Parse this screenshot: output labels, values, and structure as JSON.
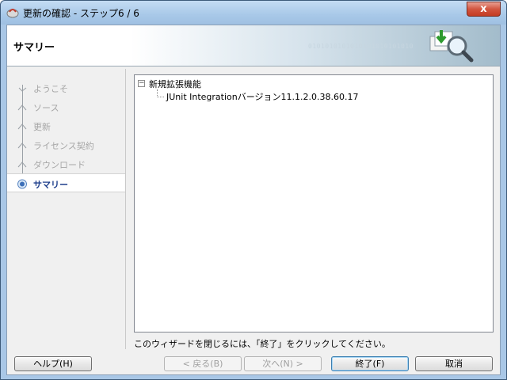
{
  "window": {
    "title": "更新の確認 - ステップ6 / 6",
    "close_glyph": "x"
  },
  "banner": {
    "title": "サマリー",
    "binary_text": "0101010101010101010101010",
    "icon": "download-magnifier-icon"
  },
  "steps": [
    {
      "label": "ようこそ",
      "state": "done"
    },
    {
      "label": "ソース",
      "state": "done"
    },
    {
      "label": "更新",
      "state": "done"
    },
    {
      "label": "ライセンス契約",
      "state": "done"
    },
    {
      "label": "ダウンロード",
      "state": "done"
    },
    {
      "label": "サマリー",
      "state": "current"
    }
  ],
  "tree": {
    "expander_glyph": "−",
    "root_label": "新規拡張機能",
    "child_label": "JUnit Integrationバージョン11.1.2.0.38.60.17"
  },
  "hint": "このウィザードを閉じるには、「終了」をクリックしてください。",
  "buttons": {
    "help": "ヘルプ(H)",
    "back": "< 戻る(B)",
    "next": "次へ(N) >",
    "finish": "終了(F)",
    "cancel": "取消"
  },
  "colors": {
    "current_step": "#1e3f8c",
    "disabled_text": "#a6a6a6",
    "close_button": "#c43b22"
  }
}
